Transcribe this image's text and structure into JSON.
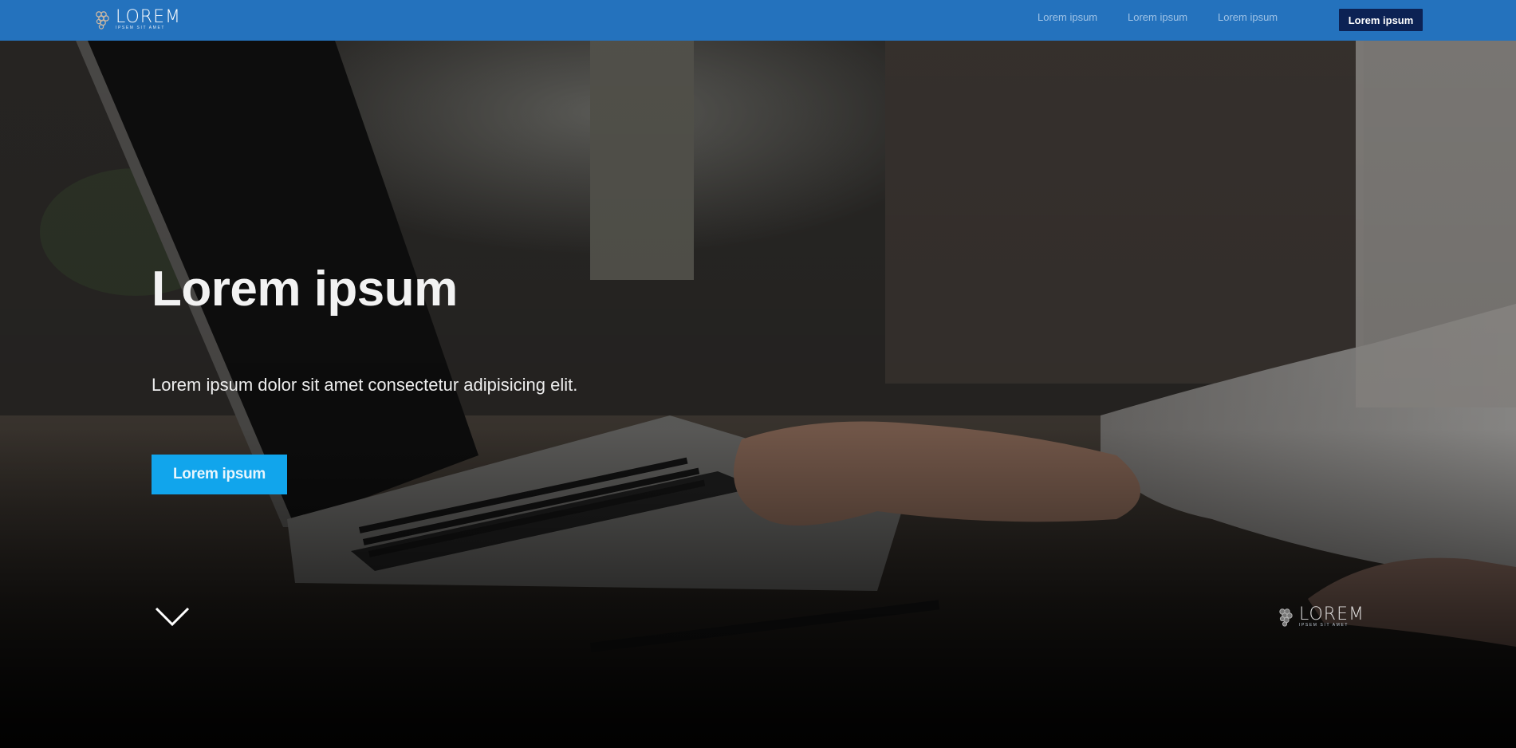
{
  "brand": {
    "name": "LOREM",
    "tagline": "IPSEM SIT AMET"
  },
  "nav": {
    "links": [
      "Lorem ipsum",
      "Lorem ipsum",
      "Lorem ipsum"
    ],
    "cta_label": "Lorem ipsum"
  },
  "hero": {
    "title": "Lorem ipsum",
    "subtitle": "Lorem ipsum dolor sit amet consectetur adipisicing elit.",
    "cta_label": "Lorem ipsum"
  },
  "footer_brand": {
    "name": "LOREM",
    "tagline": "IPSEM SIT AMET"
  },
  "icons": {
    "logo": "grapes-logo-icon",
    "scroll": "chevron-down-icon"
  },
  "colors": {
    "navbar": "#2472bd",
    "nav_cta": "#0c2254",
    "hero_cta": "#11a5ec",
    "nav_link": "#9fc3e6"
  }
}
